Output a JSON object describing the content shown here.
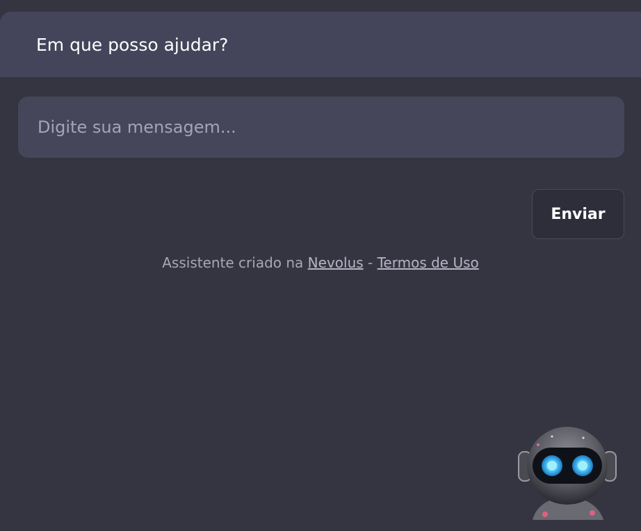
{
  "header": {
    "title": "Em que posso ajudar?"
  },
  "composer": {
    "placeholder": "Digite sua mensagem...",
    "value": "",
    "send_label": "Enviar"
  },
  "footer": {
    "prefix": "Assistente criado na",
    "brand_link": "Nevolus",
    "separator": "-",
    "terms_link": "Termos de Uso"
  },
  "colors": {
    "background": "#353542",
    "header_bg": "#44445a",
    "input_bg": "#46465a",
    "button_bg": "#2e2e3a",
    "bot_eye": "#3ec8ff"
  },
  "icons": {
    "assistant": "robot-avatar-icon"
  }
}
